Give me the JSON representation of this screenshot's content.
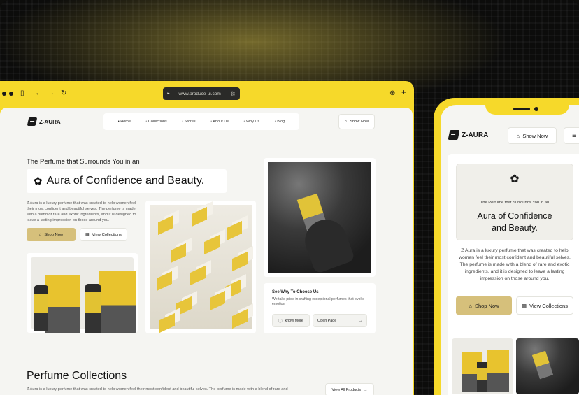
{
  "browser": {
    "url": "www.produce-ui.com",
    "brand": "Z-AURA",
    "nav": [
      "Home",
      "Collections",
      "Stores",
      "About Us",
      "Why Us",
      "Blog"
    ],
    "show_now": "Show Now",
    "hero": {
      "subtitle": "The Perfume that Surrounds You in an",
      "title": "Aura of Confidence and Beauty.",
      "description": "Z Aura is a luxury perfume that was created to help women feel their most confident and beautiful selves. The perfume is made with a blend of rare and exotic ingredients, and it is designed to leave a lasting impression on those around you.",
      "shop_now": "Shop Now",
      "view_collections": "View Collections"
    },
    "why": {
      "title": "See Why To Choose Us",
      "text": "We take pride in crafting exceptional perfumes that evoke emotion",
      "know_more": "know More",
      "open_page": "Open Page"
    },
    "collections": {
      "title": "Perfume Collections",
      "description": "Z Aura is a luxury perfume that was created to help women feel their most confident and beautiful selves. The perfume is made with a blend of rare and",
      "view_all": "View All Products"
    }
  },
  "phone": {
    "brand": "Z-AURA",
    "show_now": "Show Now",
    "subtitle": "The Perfume that Surrounds You in an",
    "title_line1": "Aura of Confidence",
    "title_line2": "and Beauty.",
    "description": "Z Aura is a luxury perfume that was created to help women feel their most confident and beautiful selves. The perfume is made with a blend of rare and exotic ingredients, and it is designed to leave a lasting impression on those around you.",
    "shop_now": "Shop Now",
    "view_collections": "View Collections"
  },
  "colors": {
    "accent": "#f6d92a",
    "gold_button": "#d6c07b",
    "page_bg": "#f5f5f2",
    "dark": "#1a1a1a"
  }
}
